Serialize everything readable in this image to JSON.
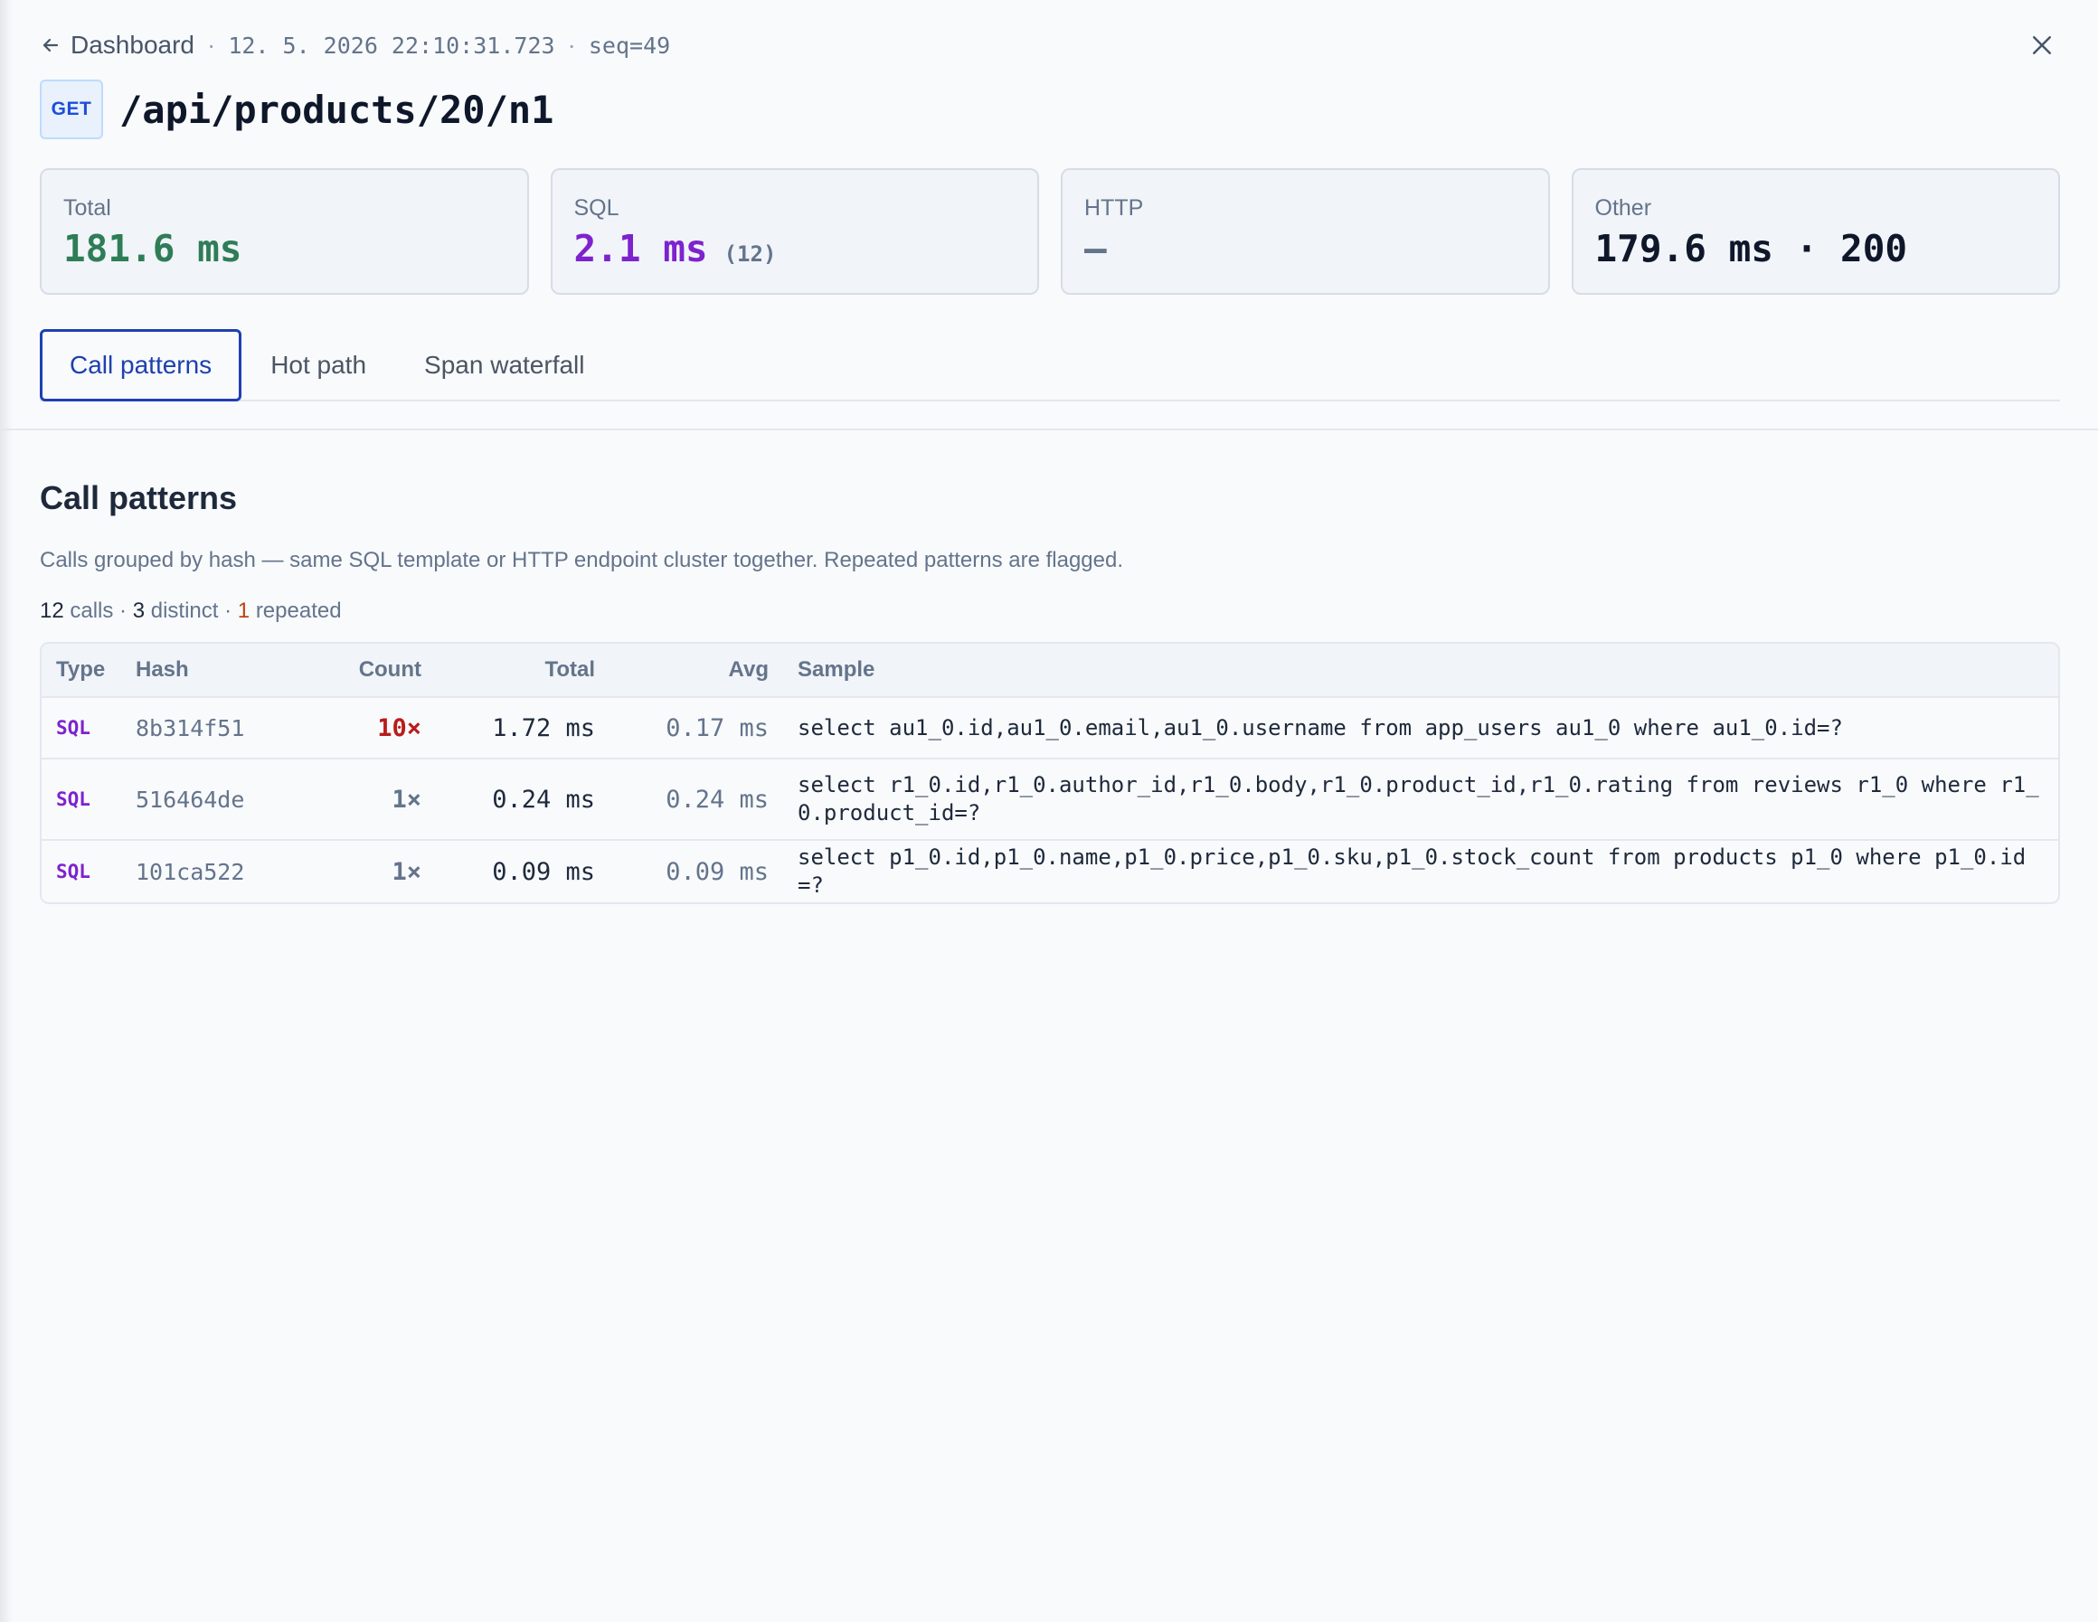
{
  "header": {
    "back_label": "Dashboard",
    "timestamp": "12. 5. 2026 22:10:31.723",
    "seq": "seq=49",
    "method": "GET",
    "endpoint": "/api/products/20/n1"
  },
  "stats": {
    "total": {
      "label": "Total",
      "value": "181.6 ms"
    },
    "sql": {
      "label": "SQL",
      "value": "2.1 ms",
      "count": "(12)"
    },
    "http": {
      "label": "HTTP",
      "value": "—"
    },
    "other": {
      "label": "Other",
      "value": "179.6 ms · 200"
    }
  },
  "tabs": [
    {
      "label": "Call patterns",
      "active": true
    },
    {
      "label": "Hot path",
      "active": false
    },
    {
      "label": "Span waterfall",
      "active": false
    }
  ],
  "section": {
    "title": "Call patterns",
    "description": "Calls grouped by hash — same SQL template or HTTP endpoint cluster together. Repeated patterns are flagged.",
    "summary": {
      "calls": "12",
      "calls_label": "calls",
      "distinct": "3",
      "distinct_label": "distinct",
      "repeated": "1",
      "repeated_label": "repeated"
    }
  },
  "table": {
    "columns": [
      "Type",
      "Hash",
      "Count",
      "Total",
      "Avg",
      "Sample"
    ],
    "rows": [
      {
        "type": "SQL",
        "hash": "8b314f51",
        "count": "10×",
        "total": "1.72 ms",
        "avg": "0.17 ms",
        "sample": "select au1_0.id,au1_0.email,au1_0.username from app_users au1_0 where au1_0.id=?"
      },
      {
        "type": "SQL",
        "hash": "516464de",
        "count": "1×",
        "total": "0.24 ms",
        "avg": "0.24 ms",
        "sample": "select r1_0.id,r1_0.author_id,r1_0.body,r1_0.product_id,r1_0.rating from reviews r1_0 where r1_0.product_id=?"
      },
      {
        "type": "SQL",
        "hash": "101ca522",
        "count": "1×",
        "total": "0.09 ms",
        "avg": "0.09 ms",
        "sample": "select p1_0.id,p1_0.name,p1_0.price,p1_0.sku,p1_0.stock_count from products p1_0 where p1_0.id=?"
      }
    ]
  },
  "colors": {
    "accent": "#1e40af",
    "total_green": "#2e7d57",
    "sql_purple": "#7e22ce",
    "flag_red": "#b91c1c",
    "repeated_orange": "#c2410c"
  },
  "icons": {
    "back": "arrow-left-icon",
    "close": "close-icon"
  }
}
